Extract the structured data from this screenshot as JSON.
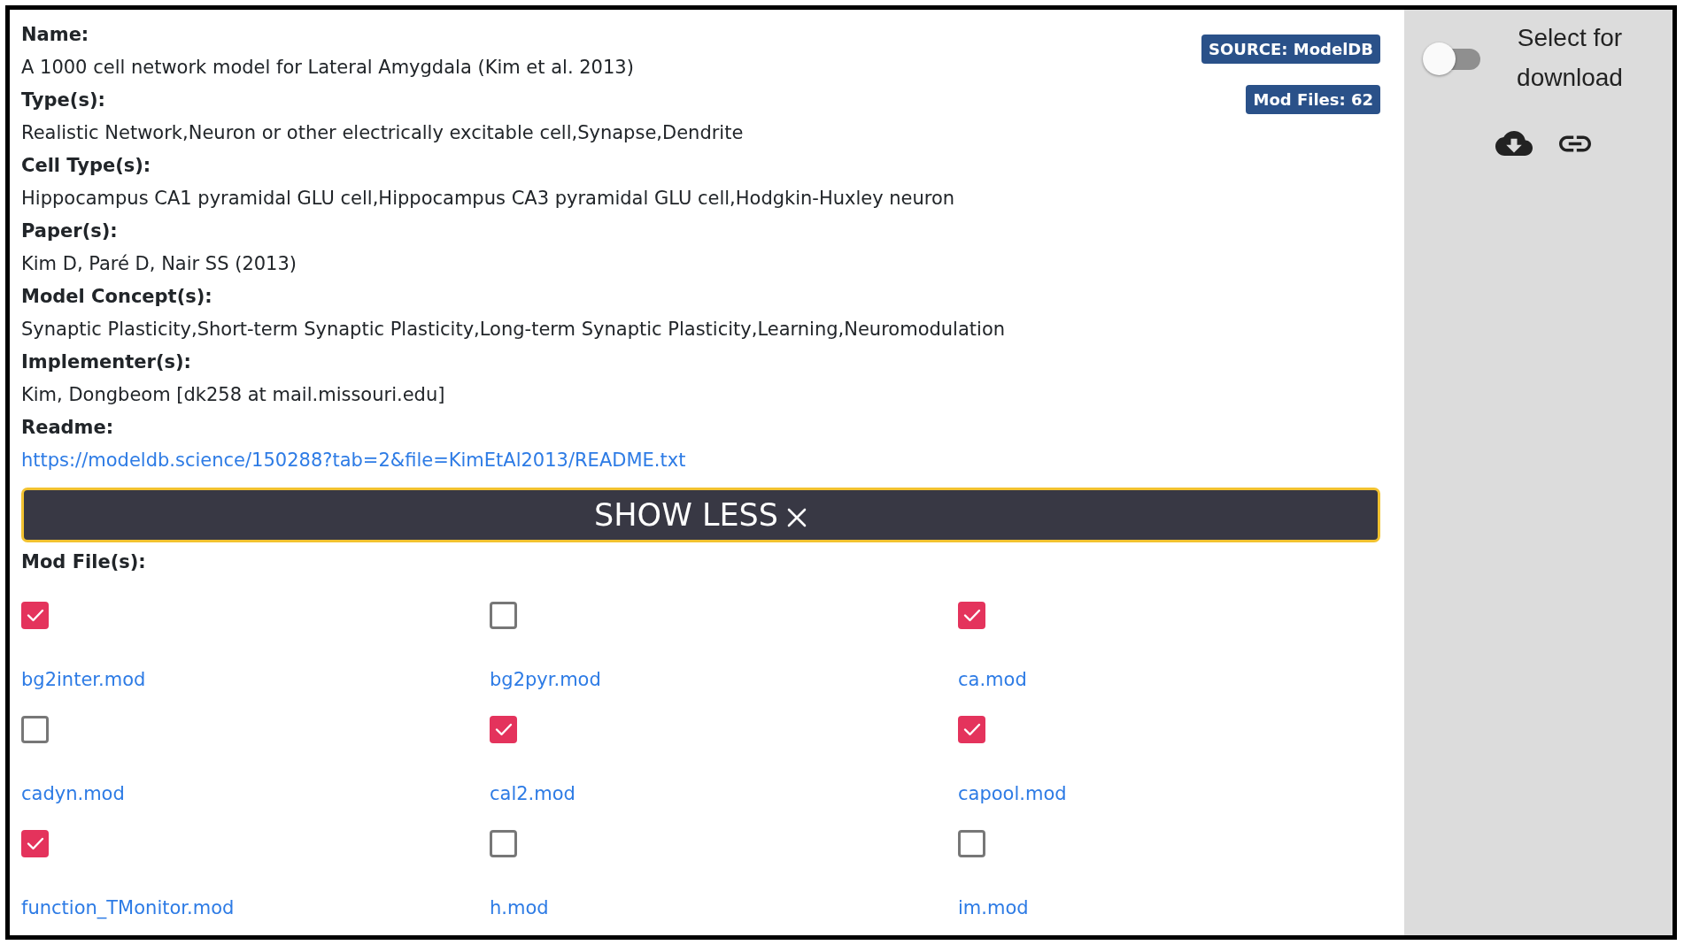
{
  "record": {
    "fields": [
      {
        "label": "Name:",
        "value": "A 1000 cell network model for Lateral Amygdala (Kim et al. 2013)",
        "kind": "text"
      },
      {
        "label": "Type(s):",
        "value": "Realistic Network,Neuron or other electrically excitable cell,Synapse,Dendrite",
        "kind": "text"
      },
      {
        "label": "Cell Type(s):",
        "value": "Hippocampus CA1 pyramidal GLU cell,Hippocampus CA3 pyramidal GLU cell,Hodgkin-Huxley neuron",
        "kind": "text"
      },
      {
        "label": "Paper(s):",
        "value": "Kim D, Paré D, Nair SS (2013)",
        "kind": "text"
      },
      {
        "label": "Model Concept(s):",
        "value": "Synaptic Plasticity,Short-term Synaptic Plasticity,Long-term Synaptic Plasticity,Learning,Neuromodulation",
        "kind": "text"
      },
      {
        "label": "Implementer(s):",
        "value": "Kim, Dongbeom [dk258 at mail.missouri.edu]",
        "kind": "text"
      },
      {
        "label": "Readme:",
        "value": "https://modeldb.science/150288?tab=2&file=KimEtAl2013/README.txt",
        "kind": "link"
      }
    ],
    "badges": [
      "SOURCE: ModelDB",
      "Mod Files: 62"
    ],
    "show_less_button": "SHOW LESS",
    "mod_files": {
      "label": "Mod File(s):",
      "files": [
        {
          "name": "bg2inter.mod",
          "checked": true
        },
        {
          "name": "bg2pyr.mod",
          "checked": false
        },
        {
          "name": "ca.mod",
          "checked": true
        },
        {
          "name": "cadyn.mod",
          "checked": false
        },
        {
          "name": "cal2.mod",
          "checked": true
        },
        {
          "name": "capool.mod",
          "checked": true
        },
        {
          "name": "function_TMonitor.mod",
          "checked": true
        },
        {
          "name": "h.mod",
          "checked": false
        },
        {
          "name": "im.mod",
          "checked": false
        }
      ]
    }
  },
  "sidebar": {
    "select_for_download": {
      "label": "Select for download",
      "on": false
    }
  }
}
